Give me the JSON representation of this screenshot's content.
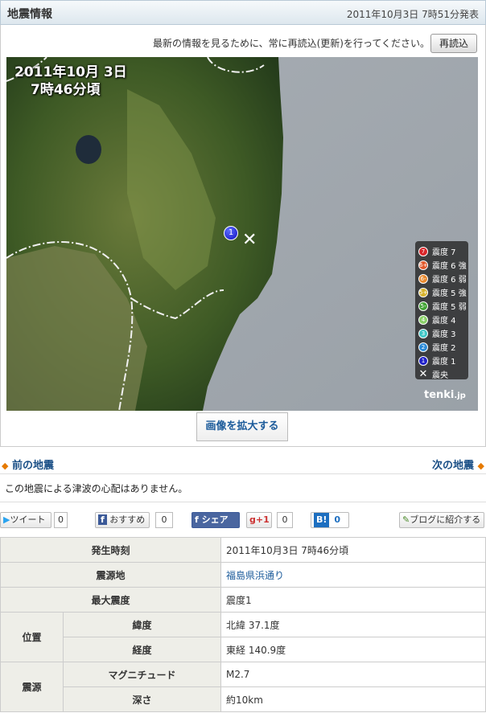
{
  "header": {
    "title": "地震情報",
    "issued": "2011年10月3日 7時51分発表"
  },
  "notice": {
    "text": "最新の情報を見るために、常に再読込(更新)を行ってください。",
    "reload_label": "再読込"
  },
  "map": {
    "date_line1": "2011年10月 3日",
    "date_line2": "7時46分頃",
    "epicenter_marker": "1",
    "epicenter_symbol": "✕",
    "logo": "tenki",
    "logo_suffix": ".jp",
    "legend": [
      {
        "marker": "7",
        "label": "震度 7",
        "color": "#d9262a"
      },
      {
        "marker": "6+",
        "label": "震度 6 強",
        "color": "#e2592b"
      },
      {
        "marker": "6-",
        "label": "震度 6 弱",
        "color": "#e8892e"
      },
      {
        "marker": "5+",
        "label": "震度 5 強",
        "color": "#d6b22a"
      },
      {
        "marker": "5-",
        "label": "震度 5 弱",
        "color": "#43a436"
      },
      {
        "marker": "4",
        "label": "震度 4",
        "color": "#8bd06a"
      },
      {
        "marker": "3",
        "label": "震度 3",
        "color": "#3ec7c7"
      },
      {
        "marker": "2",
        "label": "震度 2",
        "color": "#2c8bd9"
      },
      {
        "marker": "1",
        "label": "震度 1",
        "color": "#2121c9"
      }
    ],
    "legend_epicenter_label": "震央",
    "enlarge_label": "画像を拡大する"
  },
  "nav": {
    "prev_label": "前の地震",
    "next_label": "次の地震"
  },
  "tsunami_text": "この地震による津波の心配はありません。",
  "social": {
    "tweet_label": "ツイート",
    "tweet_count": "0",
    "recommend_label": "おすすめ",
    "recommend_count": "0",
    "share_label": "シェア",
    "gplus_label": "+1",
    "gplus_count": "0",
    "hatena_count": "0",
    "blog_label": "ブログに紹介する"
  },
  "details": {
    "time_label": "発生時刻",
    "time_value": "2011年10月3日 7時46分頃",
    "region_label": "震源地",
    "region_value": "福島県浜通り",
    "max_label": "最大震度",
    "max_value": "震度1",
    "position_label": "位置",
    "lat_label": "緯度",
    "lat_value": "北緯 37.1度",
    "lon_label": "経度",
    "lon_value": "東経 140.9度",
    "source_label": "震源",
    "mag_label": "マグニチュード",
    "mag_value": "M2.7",
    "depth_label": "深さ",
    "depth_value": "約10km"
  }
}
